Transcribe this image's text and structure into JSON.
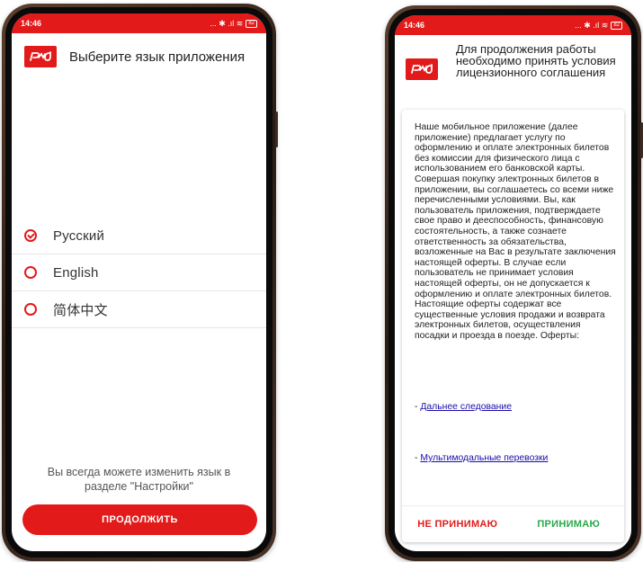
{
  "left_screen": {
    "status": {
      "time": "14:46",
      "icons_text": "... ✱ .ıl ≋",
      "battery": "82"
    },
    "title": "Выберите язык приложения",
    "languages": [
      {
        "label": "Русский",
        "selected": true
      },
      {
        "label": "English",
        "selected": false
      },
      {
        "label": "简体中文",
        "selected": false
      }
    ],
    "hint": "Вы всегда можете изменить язык в разделе \"Настройки\"",
    "continue_label": "ПРОДОЛЖИТЬ"
  },
  "right_screen": {
    "status": {
      "time": "14:46",
      "icons_text": "... ✱ .ıl ≋",
      "battery": "82"
    },
    "title": "Для продолжения работы необходимо принять условия лицензионного соглашения",
    "agreement_text": "Наше мобильное приложение (далее приложение) предлагает услугу по оформлению и оплате электронных билетов без комиссии для физического лица с использованием его банковской карты. Совершая покупку электронных билетов в приложении, вы соглашаетесь со всеми ниже перечисленными условиями. Вы, как пользователь приложения, подтверждаете свое право и дееспособность, финансовую состоятельность, а также сознаете ответственность за обязательства, возложенные на Вас в результате заключения настоящей оферты. В случае если пользователь не принимает условия настоящей оферты, он не допускается к оформлению и оплате электронных билетов. Настоящие оферты содержат все существенные условия продажи и возврата электронных билетов, осуществления посадки и проезда в поезде. Оферты:",
    "link_prefix": "- ",
    "links": [
      "Дальнее следование",
      "Мультимодальные перевозки"
    ],
    "decline_label": "НЕ ПРИНИМАЮ",
    "accept_label": "ПРИНИМАЮ"
  },
  "colors": {
    "brand_red": "#e21a1a",
    "accept_green": "#2aa84a",
    "link_blue": "#1a0dab"
  },
  "icons": [
    "rzd-logo",
    "radio-checked-icon",
    "radio-unchecked-icon",
    "wifi-icon",
    "signal-icon",
    "bluetooth-icon",
    "battery-icon"
  ]
}
